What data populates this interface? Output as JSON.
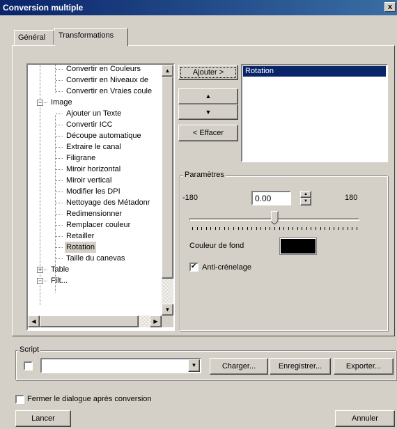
{
  "window": {
    "title": "Conversion multiple",
    "close": "x"
  },
  "tabs": [
    {
      "label": "Général"
    },
    {
      "label": "Transformations"
    }
  ],
  "tree": {
    "items": [
      "Convertir en Couleurs",
      "Convertir en Niveaux de",
      "Convertir en Vraies coule",
      "Image",
      "Ajouter un Texte",
      "Convertir ICC",
      "Découpe automatique",
      "Extraire le canal",
      "Filigrane",
      "Miroir horizontal",
      "Miroir vertical",
      "Modifier les DPI",
      "Nettoyage des Métadonr",
      "Redimensionner",
      "Remplacer couleur",
      "Retailler",
      "Rotation",
      "Taille du canevas",
      "Table",
      "Filt..."
    ],
    "selected": "Rotation",
    "expand_minus": "−",
    "expand_plus": "+"
  },
  "buttons": {
    "add": "Ajouter >",
    "up": "▲",
    "down": "▼",
    "clear": "< Effacer"
  },
  "selected_list": {
    "items": [
      "Rotation"
    ]
  },
  "params": {
    "legend": "Paramètres",
    "min": "-180",
    "max": "180",
    "value": "0.00",
    "slider_fraction": 0.5,
    "bg_color_label": "Couleur de fond",
    "bg_color": "#000000",
    "antialias_label": "Anti-crénelage",
    "antialias_checked": true,
    "check_mark": "✔"
  },
  "script": {
    "legend": "Script",
    "value": "",
    "load": "Charger...",
    "save": "Enregistrer...",
    "export": "Exporter..."
  },
  "close_after": {
    "label": "Fermer le dialogue après conversion",
    "checked": false
  },
  "footer": {
    "run": "Lancer",
    "cancel": "Annuler"
  },
  "colors": {
    "selection": "#0a246a",
    "face": "#d4d0c8"
  }
}
